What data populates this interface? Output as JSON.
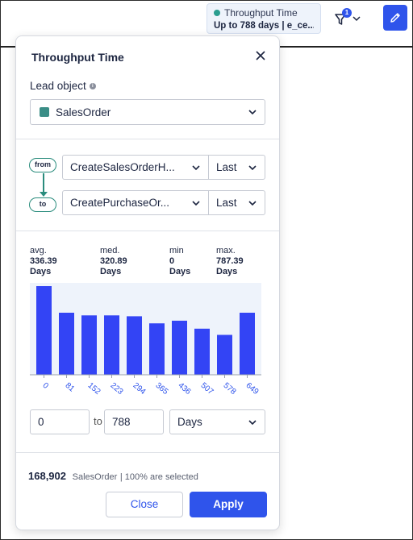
{
  "topbar": {
    "chip_title": "Throughput Time",
    "chip_value": "Up to 788 days | e_ce...",
    "filter_count": "1",
    "colors": {
      "accent": "#2f54eb",
      "teal": "#2a9d8f"
    }
  },
  "popup": {
    "title": "Throughput Time",
    "lead_label": "Lead object",
    "lead_value": "SalesOrder",
    "from_label": "from",
    "to_label": "to",
    "from_event": "CreateSalesOrderH...",
    "from_occurrence": "Last",
    "to_event": "CreatePurchaseOr...",
    "to_occurrence": "Last",
    "stats": [
      {
        "label": "avg.",
        "value": "336.39",
        "unit": "Days"
      },
      {
        "label": "med.",
        "value": "320.89",
        "unit": "Days"
      },
      {
        "label": "min",
        "value": "0",
        "unit": "Days"
      },
      {
        "label": "max.",
        "value": "787.39",
        "unit": "Days"
      }
    ],
    "range_from": "0",
    "range_to_label": "to",
    "range_to": "788",
    "range_unit": "Days",
    "count": "168,902",
    "count_object": "SalesOrder",
    "count_suffix": "| 100% are selected",
    "close_label": "Close",
    "apply_label": "Apply"
  },
  "chart_data": {
    "type": "bar",
    "categories": [
      "0",
      "81",
      "152",
      "223",
      "294",
      "365",
      "436",
      "507",
      "578",
      "649"
    ],
    "values": [
      100,
      70,
      67,
      67,
      66,
      58,
      61,
      52,
      45,
      70
    ],
    "ylim": [
      0,
      100
    ],
    "bar_color": "#3344f5",
    "background": "#eef3fb"
  }
}
